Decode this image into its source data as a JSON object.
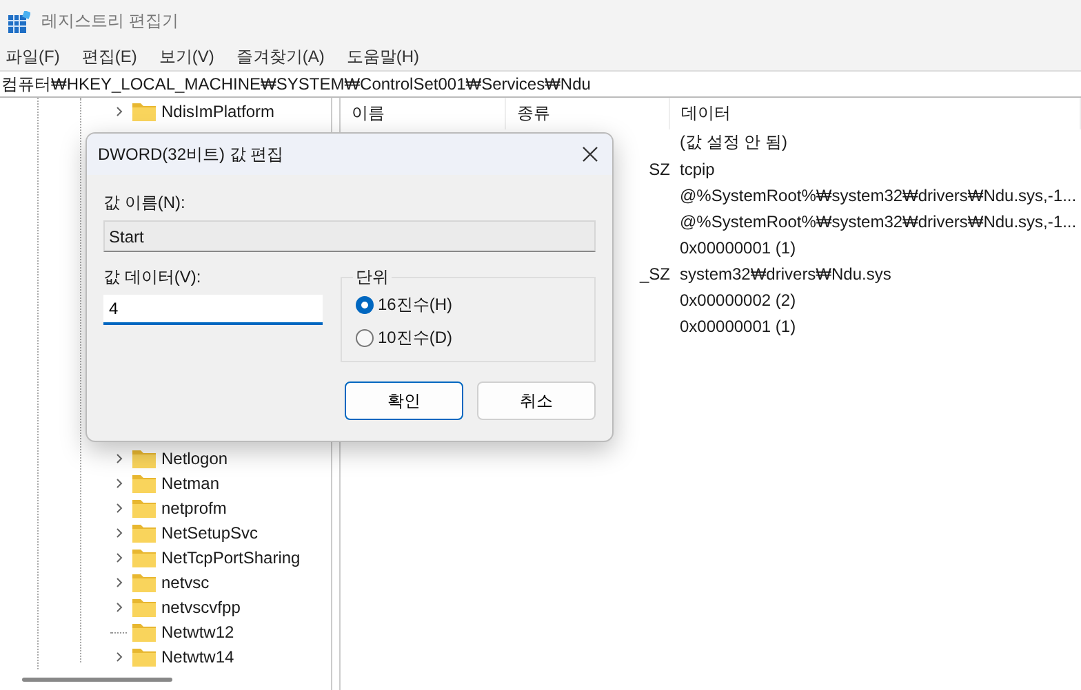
{
  "window": {
    "title": "레지스트리 편집기"
  },
  "menu": [
    "파일(F)",
    "편집(E)",
    "보기(V)",
    "즐겨찾기(A)",
    "도움말(H)"
  ],
  "address": "컴퓨터₩HKEY_LOCAL_MACHINE₩SYSTEM₩ControlSet001₩Services₩Ndu",
  "tree": {
    "top_items": [
      {
        "label": "NdisImPlatform",
        "expandable": true
      }
    ],
    "items": [
      {
        "label": "Netlogon",
        "expandable": true
      },
      {
        "label": "Netman",
        "expandable": true
      },
      {
        "label": "netprofm",
        "expandable": true
      },
      {
        "label": "NetSetupSvc",
        "expandable": true
      },
      {
        "label": "NetTcpPortSharing",
        "expandable": true
      },
      {
        "label": "netvsc",
        "expandable": true
      },
      {
        "label": "netvscvfpp",
        "expandable": true
      },
      {
        "label": "Netwtw12",
        "expandable": false
      },
      {
        "label": "Netwtw14",
        "expandable": true
      }
    ]
  },
  "table": {
    "columns": [
      "이름",
      "종류",
      "데이터"
    ],
    "rows": [
      {
        "type": "",
        "data": "(값 설정 안 됨)"
      },
      {
        "type": "SZ",
        "data": "tcpip"
      },
      {
        "type": "",
        "data": "@%SystemRoot%₩system32₩drivers₩Ndu.sys,-1..."
      },
      {
        "type": "",
        "data": "@%SystemRoot%₩system32₩drivers₩Ndu.sys,-1..."
      },
      {
        "type": "",
        "data": "0x00000001 (1)"
      },
      {
        "type": "_SZ",
        "data": "system32₩drivers₩Ndu.sys"
      },
      {
        "type": "",
        "data": "0x00000002 (2)"
      },
      {
        "type": "",
        "data": "0x00000001 (1)"
      }
    ]
  },
  "dialog": {
    "title": "DWORD(32비트) 값 편집",
    "name_label": "값 이름(N):",
    "name_value": "Start",
    "data_label": "값 데이터(V):",
    "data_value": "4",
    "base_label": "단위",
    "bases": [
      {
        "label": "16진수(H)",
        "selected": true
      },
      {
        "label": "10진수(D)",
        "selected": false
      }
    ],
    "buttons": [
      {
        "label": "확인",
        "default": true
      },
      {
        "label": "취소",
        "default": false
      }
    ]
  }
}
